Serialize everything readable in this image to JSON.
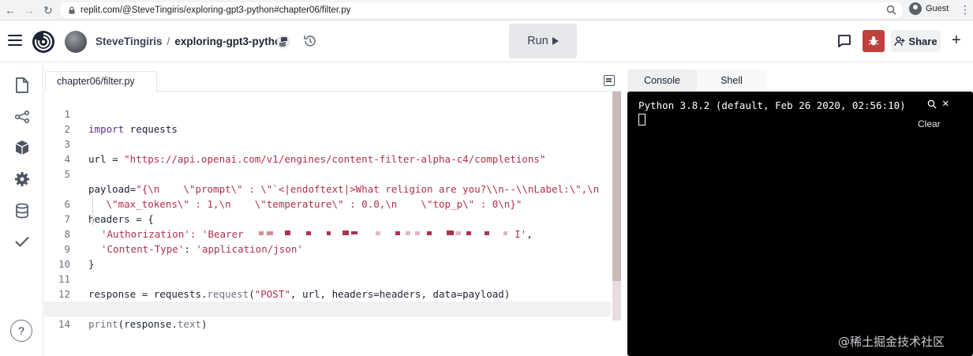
{
  "browser": {
    "url": "replit.com/@SteveTingiris/exploring-gpt3-python#chapter06/filter.py",
    "profile_label": "Guest"
  },
  "header": {
    "username": "SteveTingiris",
    "separator": "/",
    "repl_name": "exploring-gpt3-python",
    "run_label": "Run",
    "share_label": "Share"
  },
  "editor": {
    "file_tab": "chapter06/filter.py",
    "lines": [
      {
        "n": "1"
      },
      {
        "n": "2"
      },
      {
        "n": "3"
      },
      {
        "n": "4"
      },
      {
        "n": "5"
      },
      {
        "n": ""
      },
      {
        "n": "6"
      },
      {
        "n": "7"
      },
      {
        "n": "8"
      },
      {
        "n": "9"
      },
      {
        "n": "10"
      },
      {
        "n": "11"
      },
      {
        "n": "12"
      },
      {
        "n": "13"
      },
      {
        "n": "14"
      }
    ],
    "tokens": {
      "l1_kw": "import",
      "l1_rest": " requests",
      "l3_a": "url = ",
      "l3_str": "\"https://api.openai.com/v1/engines/content-filter-alpha-c4/completions\"",
      "l5_a": "payload=",
      "l5_str": "\"{\\n    \\\"prompt\\\" : \\\"`<|endoftext|>What religion are you?\\\\n--\\\\nLabel:\\\",\\n",
      "l5b_str": "   \\\"max_tokens\\\" : 1,\\n    \\\"temperature\\\" : 0.0,\\n    \\\"top_p\\\" : 0\\n}\"",
      "l6": "headers = {",
      "l7_str": "'Authorization': 'Bearer ",
      "l7_end": "I'",
      "l7_comma": ",",
      "l8_str1": "'Content-Type'",
      "l8_mid": ": ",
      "l8_str2": "'application/json'",
      "l9": "}",
      "l11_a": "response = requests.",
      "l11_fn": "request",
      "l11_b": "(",
      "l11_str": "\"POST\"",
      "l11_c": ", url, headers=headers, data=payload)",
      "l13_fn": "print",
      "l13_b": "(response.",
      "l13_fn2": "text",
      "l13_c": ")"
    }
  },
  "console": {
    "tab_console": "Console",
    "tab_shell": "Shell",
    "banner": "Python 3.8.2 (default, Feb 26 2020, 02:56:10)",
    "clear_label": "Clear"
  },
  "watermark": "@稀土掘金技术社区",
  "colors": {
    "keyword": "#5a2e8f",
    "string": "#b0314b",
    "bug_button": "#c1403d",
    "terminal_bg": "#000000"
  },
  "icons": {
    "rail": [
      "files-icon",
      "version-control-icon",
      "packages-icon",
      "settings-icon",
      "database-icon",
      "unit-tests-icon",
      "help-icon"
    ]
  }
}
